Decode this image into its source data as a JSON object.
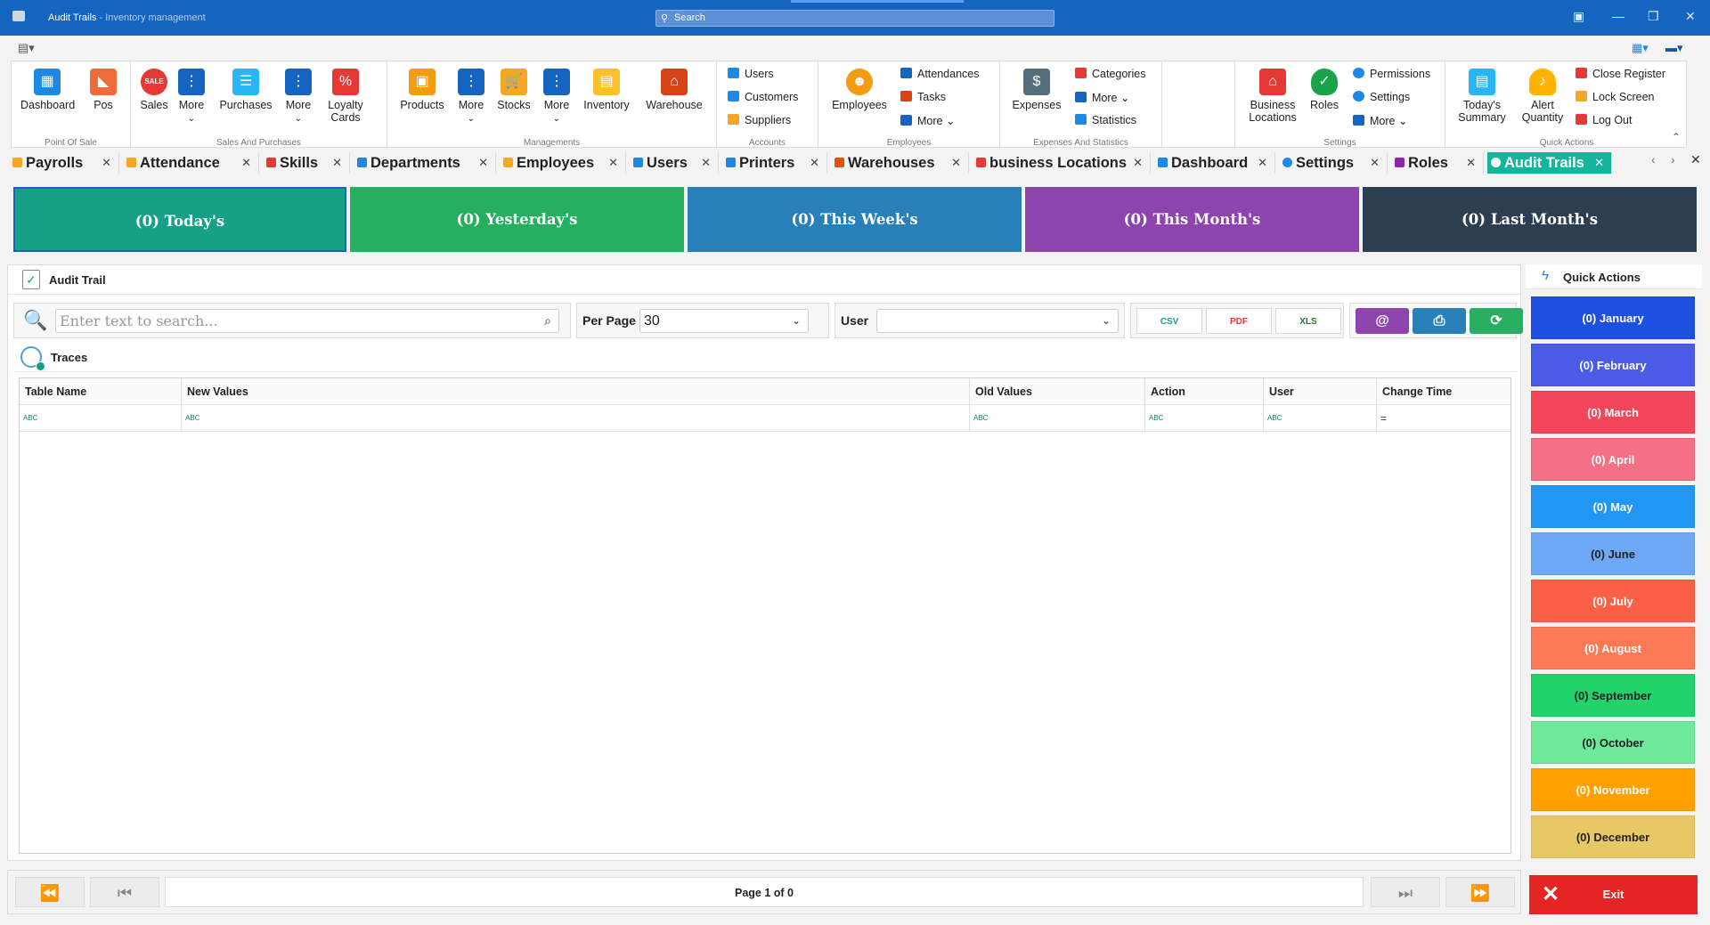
{
  "window": {
    "title": "Audit Trails",
    "subtitle": " - Inventory management",
    "search_placeholder": "Search"
  },
  "ribbon": {
    "groups": [
      {
        "caption": "Point Of Sale",
        "buttons": [
          "Dashboard",
          "Pos"
        ]
      },
      {
        "caption": "Sales And Purchases",
        "buttons": [
          "Sales",
          "More",
          "Purchases",
          "More",
          "Loyalty Cards"
        ]
      },
      {
        "caption": "Managements",
        "buttons": [
          "Products",
          "More",
          "Stocks",
          "More",
          "Inventory",
          "Warehouse"
        ]
      },
      {
        "caption": "Accounts",
        "buttons": [
          "Users",
          "Customers",
          "Suppliers"
        ]
      },
      {
        "caption": "Employees",
        "buttons": [
          "Employees",
          "Attendances",
          "Tasks",
          "More"
        ]
      },
      {
        "caption": "Expenses And Statistics",
        "buttons": [
          "Expenses",
          "Categories",
          "More",
          "Statistics"
        ]
      },
      {
        "caption": "Settings",
        "buttons": [
          "Business Locations",
          "Roles",
          "Permissions",
          "Settings",
          "More"
        ]
      },
      {
        "caption": "Quick Actions",
        "buttons": [
          "Today's Summary",
          "Alert Quantity",
          "Close Register",
          "Lock Screen",
          "Log Out"
        ]
      }
    ]
  },
  "tabs": [
    {
      "label": "Payrolls",
      "color": "#f5a623"
    },
    {
      "label": "Attendance",
      "color": "#f5a623"
    },
    {
      "label": "Skills",
      "color": "#e53935"
    },
    {
      "label": "Departments",
      "color": "#1e88e5"
    },
    {
      "label": "Employees",
      "color": "#f5a623"
    },
    {
      "label": "Users",
      "color": "#1e88e5"
    },
    {
      "label": "Printers",
      "color": "#1e88e5"
    },
    {
      "label": "Warehouses",
      "color": "#e65100"
    },
    {
      "label": "business Locations",
      "color": "#e53935"
    },
    {
      "label": "Dashboard",
      "color": "#1e88e5"
    },
    {
      "label": "Settings",
      "color": "#1e88e5"
    },
    {
      "label": "Roles",
      "color": "#8e24aa"
    },
    {
      "label": "Audit Trails",
      "color": "#ffffff"
    }
  ],
  "periods": [
    {
      "label": "(0) Today's",
      "color": "#16a085"
    },
    {
      "label": "(0) Yesterday's",
      "color": "#27ae60"
    },
    {
      "label": "(0) This Week's",
      "color": "#2980b9"
    },
    {
      "label": "(0) This Month's",
      "color": "#8e44ad"
    },
    {
      "label": "(0) Last Month's",
      "color": "#2c3e50"
    }
  ],
  "panel": {
    "title": "Audit Trail",
    "search_placeholder": "Enter text to search...",
    "per_page_label": "Per Page",
    "per_page_value": "30",
    "user_label": "User",
    "user_value": "",
    "export": [
      "CSV",
      "PDF",
      "XLS"
    ],
    "actions": [
      {
        "icon": "@",
        "color": "#8e44ad"
      },
      {
        "icon": "⎙",
        "color": "#2980b9"
      },
      {
        "icon": "⟳",
        "color": "#27ae60"
      }
    ],
    "traces_title": "Traces",
    "columns": [
      "Table Name",
      "New Values",
      "Old Values",
      "Action",
      "User",
      "Change Time"
    ],
    "filter_icons": [
      "ABC",
      "ABC",
      "ABC",
      "ABC",
      "ABC",
      "="
    ]
  },
  "pager": {
    "info": "Page 1 of 0"
  },
  "quick_actions": {
    "title": "Quick Actions",
    "months": [
      {
        "label": "(0) January",
        "bg": "#1d4fe0",
        "fg": "#ffffff"
      },
      {
        "label": "(0) February",
        "bg": "#4a5be8",
        "fg": "#ffffff"
      },
      {
        "label": "(0) March",
        "bg": "#f0455a",
        "fg": "#ffffff"
      },
      {
        "label": "(0) April",
        "bg": "#f56f85",
        "fg": "#ffffff"
      },
      {
        "label": "(0) May",
        "bg": "#2196f3",
        "fg": "#ffffff"
      },
      {
        "label": "(0) June",
        "bg": "#6ea8f5",
        "fg": "#222222"
      },
      {
        "label": "(0) July",
        "bg": "#fa6045",
        "fg": "#ffffff"
      },
      {
        "label": "(0) August",
        "bg": "#fb7a55",
        "fg": "#ffffff"
      },
      {
        "label": "(0) September",
        "bg": "#22d36b",
        "fg": "#222222"
      },
      {
        "label": "(0) October",
        "bg": "#6ee89b",
        "fg": "#222222"
      },
      {
        "label": "(0) November",
        "bg": "#ffa000",
        "fg": "#ffffff"
      },
      {
        "label": "(0) December",
        "bg": "#e8c765",
        "fg": "#222222"
      }
    ],
    "exit_label": "Exit"
  }
}
